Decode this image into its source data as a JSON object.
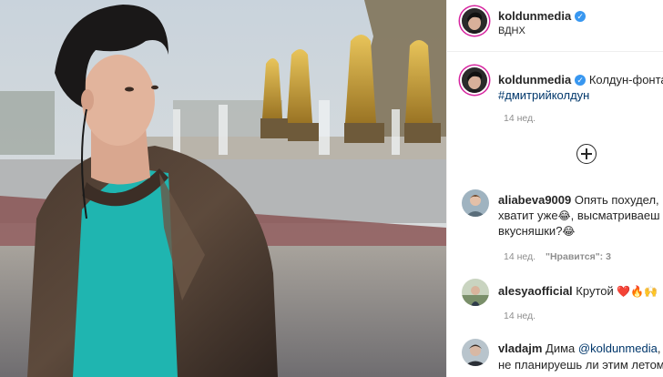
{
  "post": {
    "author": "koldunmedia",
    "location": "ВДНХ",
    "verified": true
  },
  "caption": {
    "username": "koldunmedia",
    "text": "Колдун-фонта",
    "hashtag": "#дмитрийколдун",
    "time": "14 нед."
  },
  "load_more_icon": "plus-circle-icon",
  "comments": [
    {
      "username": "aliabeva9009",
      "line1": "Опять похудел,",
      "line2_a": "хватит уже",
      "line2_emoji": "😂",
      "line2_b": ", высматриваеш",
      "line3_a": "вкусняшки?",
      "line3_emoji": "😂",
      "time": "14 нед.",
      "likes_label": "\"Нравится\": 3"
    },
    {
      "username": "alesyaofficial",
      "text": "Крутой",
      "emojis": "❤️🔥🙌",
      "time": "14 нед."
    },
    {
      "username": "vladajm",
      "line1_a": "Дима",
      "line1_mention": "@koldunmedia",
      "line1_b": ",",
      "line2": "не планируешь ли этим летом"
    }
  ]
}
